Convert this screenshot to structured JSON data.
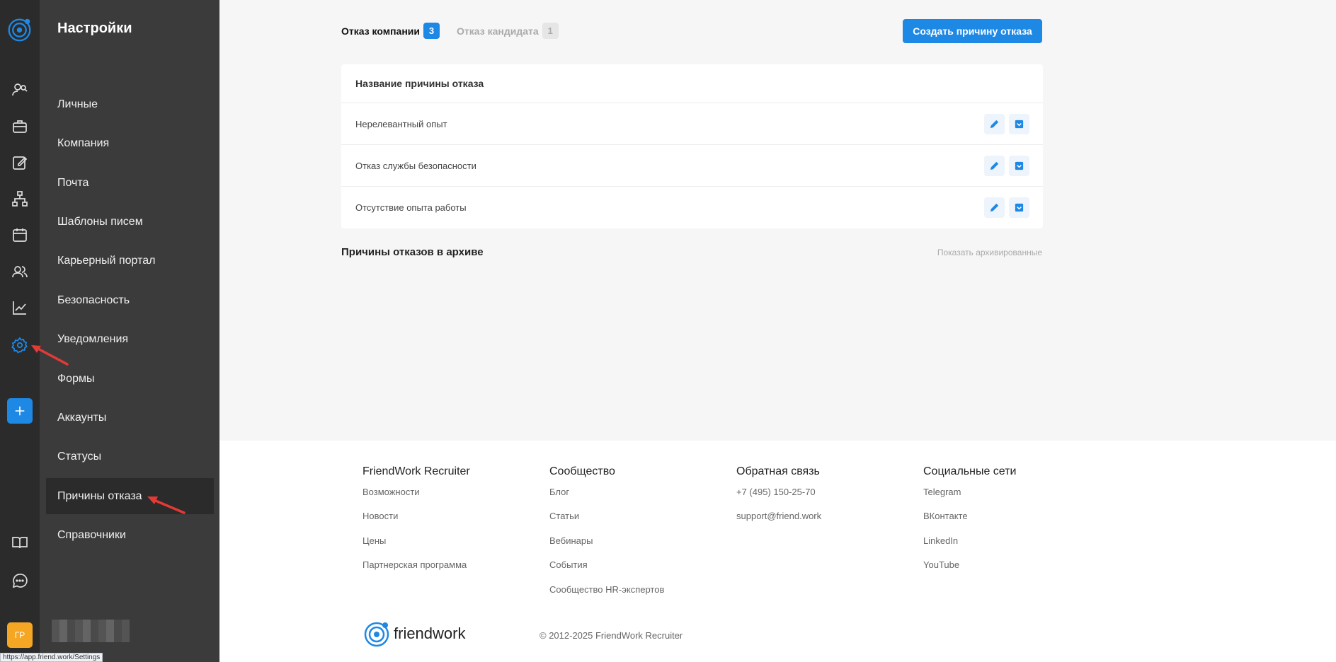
{
  "sidebar": {
    "title": "Настройки",
    "items": [
      {
        "label": "Личные"
      },
      {
        "label": "Компания"
      },
      {
        "label": "Почта"
      },
      {
        "label": "Шаблоны писем"
      },
      {
        "label": "Карьерный портал"
      },
      {
        "label": "Безопасность"
      },
      {
        "label": "Уведомления"
      },
      {
        "label": "Формы"
      },
      {
        "label": "Аккаунты"
      },
      {
        "label": "Статусы"
      },
      {
        "label": "Причины отказа",
        "active": true
      },
      {
        "label": "Справочники"
      }
    ]
  },
  "rail": {
    "icons": [
      "candidates-icon",
      "vacancies-icon",
      "tasks-icon",
      "structure-icon",
      "calendar-icon",
      "team-icon",
      "analytics-icon",
      "settings-icon"
    ],
    "avatar_initials": "ГР"
  },
  "tabs": [
    {
      "label": "Отказ компании",
      "count": "3",
      "active": true
    },
    {
      "label": "Отказ кандидата",
      "count": "1",
      "active": false
    }
  ],
  "create_button": "Создать причину отказа",
  "table": {
    "header": "Название причины отказа",
    "rows": [
      {
        "name": "Нерелевантный опыт"
      },
      {
        "name": "Отказ службы безопасности"
      },
      {
        "name": "Отсутствие опыта работы"
      }
    ]
  },
  "archive": {
    "title": "Причины отказов в архиве",
    "link": "Показать архивированные"
  },
  "footer": {
    "columns": [
      {
        "title": "FriendWork Recruiter",
        "links": [
          "Возможности",
          "Новости",
          "Цены",
          "Партнерская программа"
        ]
      },
      {
        "title": "Сообщество",
        "links": [
          "Блог",
          "Статьи",
          "Вебинары",
          "События",
          "Сообщество HR-экспертов"
        ]
      },
      {
        "title": "Обратная связь",
        "links": [
          "+7 (495) 150-25-70",
          "support@friend.work"
        ]
      },
      {
        "title": "Социальные сети",
        "links": [
          "Telegram",
          "ВКонтакте",
          "LinkedIn",
          "YouTube"
        ]
      }
    ],
    "logo_text": "friendwork",
    "copyright": "© 2012-2025 FriendWork Recruiter"
  },
  "status_url": "https://app.friend.work/Settings",
  "colors": {
    "accent": "#1e88e5",
    "rail_bg": "#2b2b2b",
    "sidebar_bg": "#3b3b3b",
    "avatar": "#f5a623",
    "annotation_arrow": "#e53935"
  }
}
